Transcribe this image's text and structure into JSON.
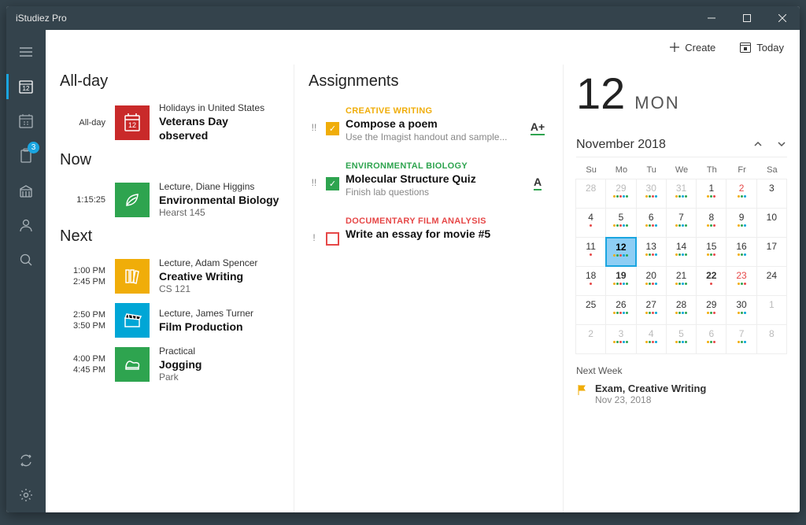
{
  "app": {
    "title": "iStudiez Pro"
  },
  "toolbar": {
    "create_label": "Create",
    "today_label": "Today"
  },
  "sidebar": {
    "badge_count": "3"
  },
  "sections": {
    "allday": "All-day",
    "now": "Now",
    "next": "Next"
  },
  "schedule": {
    "allday": [
      {
        "time_label": "All-day",
        "meta": "Holidays in United States",
        "title": "Veterans Day observed",
        "color": "#c92a2a"
      }
    ],
    "now": [
      {
        "countdown": "1:15:25",
        "meta": "Lecture, Diane Higgins",
        "title": "Environmental Biology",
        "sub": "Hearst 145",
        "color": "#2ea44f"
      }
    ],
    "next": [
      {
        "start": "1:00 PM",
        "end": "2:45 PM",
        "meta": "Lecture, Adam Spencer",
        "title": "Creative Writing",
        "sub": "CS 121",
        "color": "#f0ad09"
      },
      {
        "start": "2:50 PM",
        "end": "3:50 PM",
        "meta": "Lecture, James Turner",
        "title": "Film Production",
        "sub": "",
        "color": "#00a6d6"
      },
      {
        "start": "4:00 PM",
        "end": "4:45 PM",
        "meta": "Practical",
        "title": "Jogging",
        "sub": "Park",
        "color": "#2ea44f"
      }
    ]
  },
  "assignments_heading": "Assignments",
  "assignments": [
    {
      "priority": "!!",
      "checked": true,
      "course": "CREATIVE WRITING",
      "course_color": "#f0ad09",
      "title": "Compose a poem",
      "sub": "Use the Imagist handout and sample...",
      "grade": "A+",
      "grade_color": "#2ea44f"
    },
    {
      "priority": "!!",
      "checked": true,
      "course": "ENVIRONMENTAL BIOLOGY",
      "course_color": "#2ea44f",
      "title": "Molecular Structure Quiz",
      "sub": "Finish lab questions",
      "grade": "A",
      "grade_color": "#2ea44f"
    },
    {
      "priority": "!",
      "checked": false,
      "course": "DOCUMENTARY FILM ANALYSIS",
      "course_color": "#e64848",
      "title": "Write an essay for movie #5",
      "sub": "",
      "grade": "",
      "grade_color": "#777"
    }
  ],
  "calendar": {
    "big_day": "12",
    "big_dow": "MON",
    "month_label": "November 2018",
    "weekdays": [
      "Su",
      "Mo",
      "Tu",
      "We",
      "Th",
      "Fr",
      "Sa"
    ],
    "grid": [
      {
        "d": "28",
        "dim": true
      },
      {
        "d": "29",
        "dim": true,
        "dots": [
          "#f0ad09",
          "#2ea44f",
          "#e64848",
          "#00a6d6",
          "#2ea44f"
        ]
      },
      {
        "d": "30",
        "dim": true,
        "dots": [
          "#f0ad09",
          "#2ea44f",
          "#e64848",
          "#00a6d6"
        ]
      },
      {
        "d": "31",
        "dim": true,
        "dots": [
          "#f0ad09",
          "#2ea44f",
          "#00a6d6",
          "#2ea44f"
        ]
      },
      {
        "d": "1",
        "dots": [
          "#f0ad09",
          "#2ea44f",
          "#e64848"
        ]
      },
      {
        "d": "2",
        "red": true,
        "dots": [
          "#f0ad09",
          "#2ea44f",
          "#00a6d6"
        ]
      },
      {
        "d": "3"
      },
      {
        "d": "4",
        "dots": [
          "#e64848"
        ]
      },
      {
        "d": "5",
        "dots": [
          "#f0ad09",
          "#2ea44f",
          "#e64848",
          "#00a6d6",
          "#2ea44f"
        ]
      },
      {
        "d": "6",
        "dots": [
          "#f0ad09",
          "#2ea44f",
          "#e64848",
          "#00a6d6"
        ]
      },
      {
        "d": "7",
        "dots": [
          "#f0ad09",
          "#2ea44f",
          "#00a6d6",
          "#2ea44f"
        ]
      },
      {
        "d": "8",
        "dots": [
          "#f0ad09",
          "#2ea44f",
          "#e64848"
        ]
      },
      {
        "d": "9",
        "dots": [
          "#f0ad09",
          "#2ea44f",
          "#00a6d6"
        ]
      },
      {
        "d": "10"
      },
      {
        "d": "11",
        "dots": [
          "#e64848"
        ]
      },
      {
        "d": "12",
        "today": true,
        "dots": [
          "#f0ad09",
          "#2ea44f",
          "#e64848",
          "#00a6d6",
          "#2ea44f"
        ]
      },
      {
        "d": "13",
        "dots": [
          "#f0ad09",
          "#2ea44f",
          "#e64848",
          "#00a6d6"
        ]
      },
      {
        "d": "14",
        "dots": [
          "#f0ad09",
          "#2ea44f",
          "#00a6d6",
          "#2ea44f"
        ]
      },
      {
        "d": "15",
        "dots": [
          "#f0ad09",
          "#2ea44f",
          "#e64848"
        ]
      },
      {
        "d": "16",
        "dots": [
          "#f0ad09",
          "#2ea44f",
          "#00a6d6"
        ]
      },
      {
        "d": "17"
      },
      {
        "d": "18",
        "dots": [
          "#e64848"
        ]
      },
      {
        "d": "19",
        "bold": true,
        "dots": [
          "#f0ad09",
          "#2ea44f",
          "#e64848",
          "#00a6d6",
          "#2ea44f"
        ]
      },
      {
        "d": "20",
        "dots": [
          "#f0ad09",
          "#2ea44f",
          "#e64848",
          "#00a6d6"
        ]
      },
      {
        "d": "21",
        "dots": [
          "#f0ad09",
          "#2ea44f",
          "#00a6d6",
          "#2ea44f"
        ]
      },
      {
        "d": "22",
        "bold": true,
        "dots": [
          "#e64848"
        ]
      },
      {
        "d": "23",
        "red": true,
        "dots": [
          "#f0ad09",
          "#2ea44f",
          "#e64848"
        ]
      },
      {
        "d": "24"
      },
      {
        "d": "25"
      },
      {
        "d": "26",
        "dots": [
          "#f0ad09",
          "#2ea44f",
          "#e64848",
          "#00a6d6",
          "#2ea44f"
        ]
      },
      {
        "d": "27",
        "dots": [
          "#f0ad09",
          "#2ea44f",
          "#e64848",
          "#00a6d6"
        ]
      },
      {
        "d": "28",
        "dots": [
          "#f0ad09",
          "#2ea44f",
          "#00a6d6",
          "#2ea44f"
        ]
      },
      {
        "d": "29",
        "dots": [
          "#f0ad09",
          "#2ea44f",
          "#e64848"
        ]
      },
      {
        "d": "30",
        "dots": [
          "#f0ad09",
          "#2ea44f",
          "#00a6d6"
        ]
      },
      {
        "d": "1",
        "dim": true
      },
      {
        "d": "2",
        "dim": true
      },
      {
        "d": "3",
        "dim": true,
        "dots": [
          "#f0ad09",
          "#2ea44f",
          "#e64848",
          "#00a6d6",
          "#2ea44f"
        ]
      },
      {
        "d": "4",
        "dim": true,
        "dots": [
          "#f0ad09",
          "#2ea44f",
          "#e64848",
          "#00a6d6"
        ]
      },
      {
        "d": "5",
        "dim": true,
        "dots": [
          "#f0ad09",
          "#2ea44f",
          "#00a6d6",
          "#2ea44f"
        ]
      },
      {
        "d": "6",
        "dim": true,
        "dots": [
          "#f0ad09",
          "#2ea44f",
          "#e64848"
        ]
      },
      {
        "d": "7",
        "dim": true,
        "dots": [
          "#f0ad09",
          "#2ea44f",
          "#00a6d6"
        ]
      },
      {
        "d": "8",
        "dim": true
      }
    ],
    "next_week_label": "Next Week",
    "next_week": [
      {
        "title": "Exam, Creative Writing",
        "date": "Nov 23, 2018",
        "color": "#f0ad09"
      }
    ]
  }
}
